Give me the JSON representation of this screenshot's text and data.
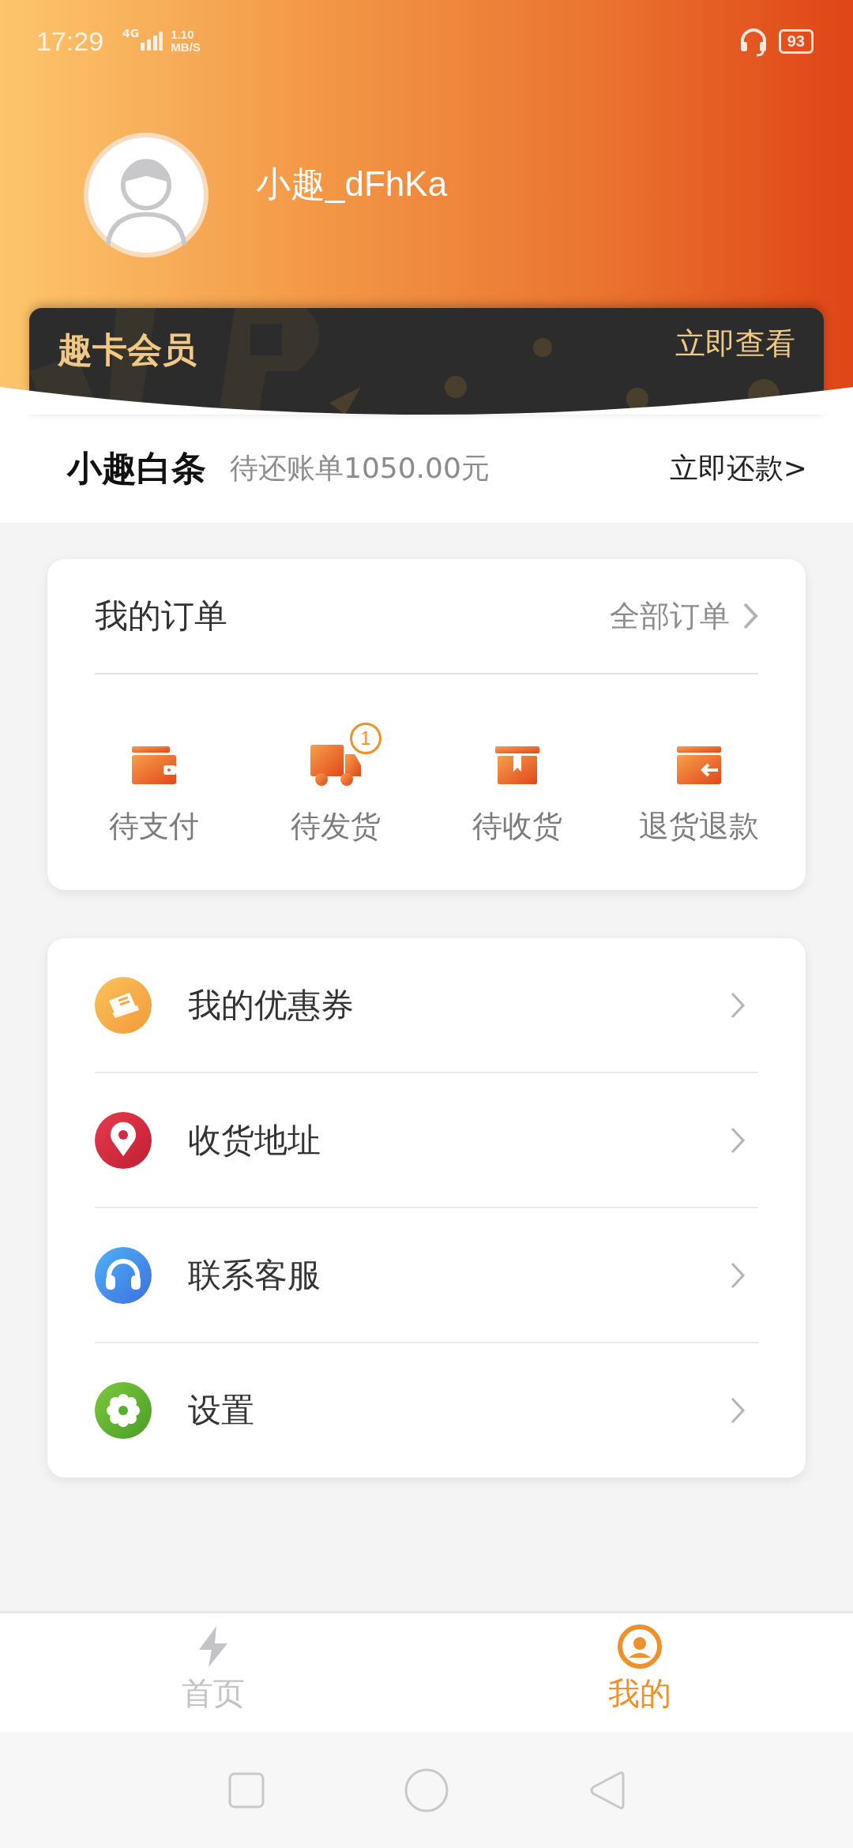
{
  "status_bar": {
    "time": "17:29",
    "network": "4G",
    "speed_value": "1.10",
    "speed_unit": "MB/S",
    "battery": "93"
  },
  "profile": {
    "username": "小趣_dFhKa"
  },
  "vip_card": {
    "title": "趣卡会员",
    "action": "立即查看"
  },
  "credit": {
    "title": "小趣白条",
    "bill": "待还账单1050.00元",
    "action": "立即还款>"
  },
  "orders": {
    "title": "我的订单",
    "all_link": "全部订单",
    "items": [
      {
        "label": "待支付"
      },
      {
        "label": "待发货",
        "badge": "1"
      },
      {
        "label": "待收货"
      },
      {
        "label": "退货退款"
      }
    ]
  },
  "menu": [
    {
      "label": "我的优惠券"
    },
    {
      "label": "收货地址"
    },
    {
      "label": "联系客服"
    },
    {
      "label": "设置"
    }
  ],
  "tabs": [
    {
      "label": "首页",
      "selected": false
    },
    {
      "label": "我的",
      "selected": true
    }
  ]
}
